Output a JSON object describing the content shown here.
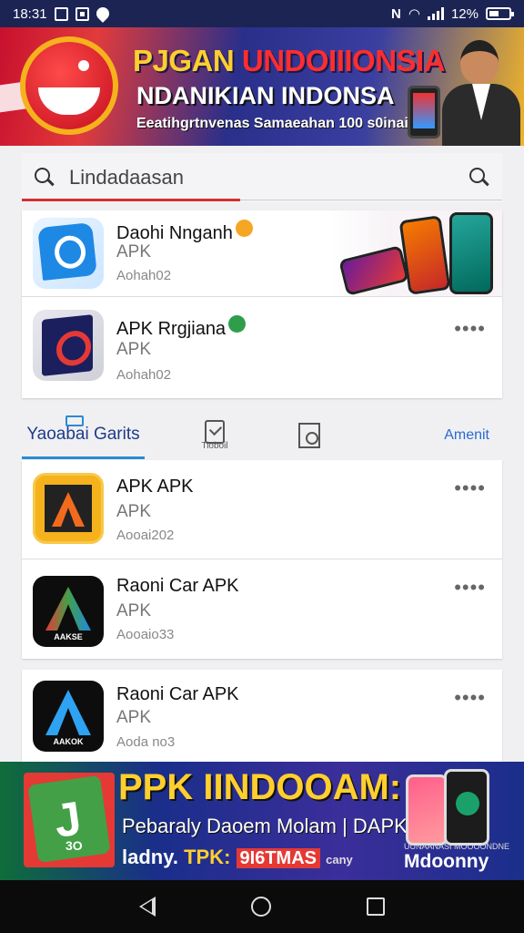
{
  "status_bar": {
    "time": "18:31",
    "network_letter": "N",
    "battery": "12%"
  },
  "top_banner": {
    "line1_a": "PJGAN ",
    "line1_b": "UNDOIIIONSIA",
    "line2": "NDANIKIAN INDONSA",
    "line3": "Eeatihgrtnvenas Samaeahan 100 s0inaio"
  },
  "search": {
    "placeholder": "Lindadaasan"
  },
  "featured": [
    {
      "name": "Daohi Nnganh",
      "type": "APK",
      "version": "Aohah02",
      "badge_color": "#f5a623"
    },
    {
      "name": "APK Rrgjiana",
      "type": "APK",
      "version": "Aohah02",
      "badge_color": "#2e9e4a"
    }
  ],
  "tabs": {
    "active": "Yaoabai Garits",
    "icon1_label": "Tioboil",
    "link": "Amenit"
  },
  "list": [
    {
      "name": "APK APK",
      "type": "APK",
      "version": "Aooai202",
      "icon_label": ""
    },
    {
      "name": "Raoni Car APK",
      "type": "APK",
      "version": "Aooaio33",
      "icon_label": "AAKSE"
    },
    {
      "name": "Raoni Car APK",
      "type": "APK",
      "version": "Aoda no3",
      "icon_label": "AAKOK"
    }
  ],
  "more_label": "••••",
  "bottom_banner": {
    "title": "PPK IINDOOAM:",
    "line2": "Pebaraly Daoem Molam | DAPK",
    "line3_a": "ladny. ",
    "line3_b": "TPK:",
    "line3_c": "9I6TMAS",
    "line3_d": "cany",
    "logo_version": "3O",
    "brand_small": "UUNAANASI MOOOONDNE",
    "brand": "Mdoonny"
  }
}
